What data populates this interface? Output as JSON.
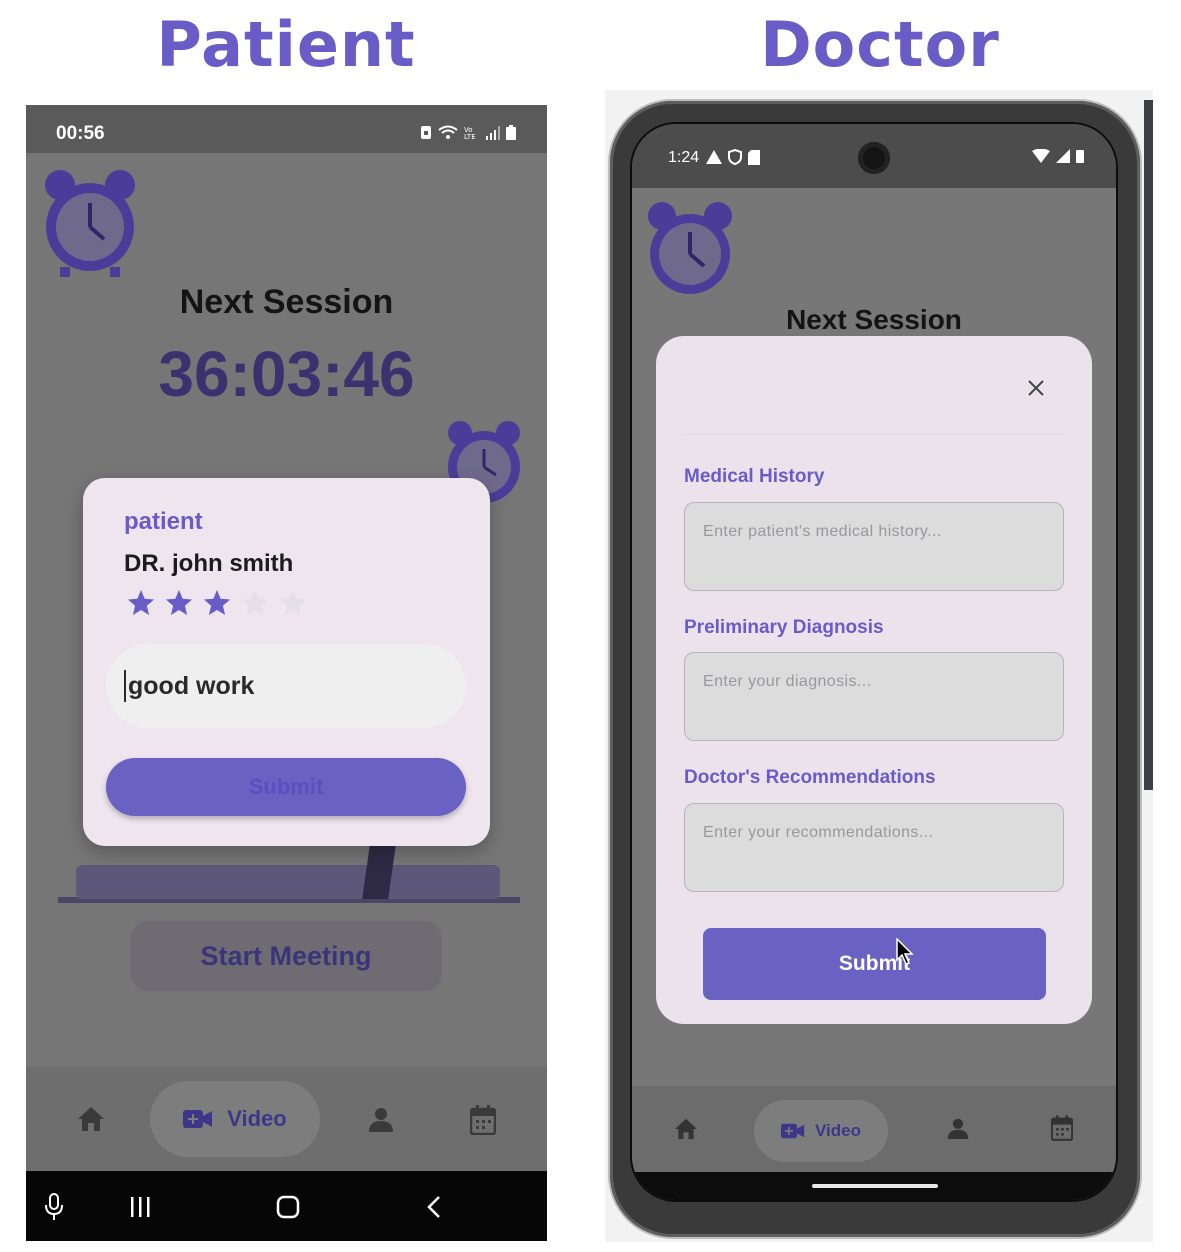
{
  "headings": {
    "patient": "Patient",
    "doctor": "Doctor"
  },
  "patient_screen": {
    "status": {
      "time": "00:56"
    },
    "title": "Next Session",
    "countdown": "36:03:46",
    "start_meeting_label": "Start Meeting",
    "rating_dialog": {
      "role": "patient",
      "doctor_name": "DR. john smith",
      "rating": 3,
      "max_rating": 5,
      "comment": "good work",
      "submit_label": "Submit"
    },
    "nav": {
      "video_label": "Video"
    }
  },
  "doctor_screen": {
    "status": {
      "time": "1:24"
    },
    "title": "Next Session",
    "form": {
      "fields": [
        {
          "label": "Medical History",
          "placeholder": "Enter patient's medical history..."
        },
        {
          "label": "Preliminary Diagnosis",
          "placeholder": "Enter your diagnosis..."
        },
        {
          "label": "Doctor's Recommendations",
          "placeholder": "Enter your recommendations..."
        }
      ],
      "submit_label": "Submit"
    },
    "nav": {
      "video_label": "Video"
    }
  },
  "colors": {
    "accent": "#6a5cc7",
    "button": "#6a62c2",
    "dialog": "#efe5ef",
    "overlay": "#767676"
  },
  "icons": [
    "alarm-clock-icon",
    "home-icon",
    "video-camera-icon",
    "user-icon",
    "calendar-icon",
    "star-icon",
    "close-icon",
    "microphone-icon",
    "recents-icon",
    "home-circle-icon",
    "back-icon",
    "wifi-icon",
    "signal-icon",
    "battery-icon",
    "cursor-icon"
  ]
}
